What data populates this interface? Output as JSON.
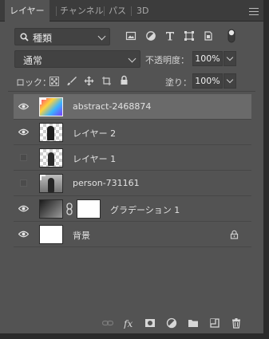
{
  "tabs": [
    {
      "label": "レイヤー",
      "active": true
    },
    {
      "label": "チャンネル",
      "active": false
    },
    {
      "label": "パス",
      "active": false
    },
    {
      "label": "3D",
      "active": false
    }
  ],
  "filter": {
    "label": "種類",
    "icons": [
      "image-filter-icon",
      "adjustment-filter-icon",
      "type-filter-icon",
      "shape-filter-icon",
      "smart-object-filter-icon",
      "filter-toggle-icon"
    ]
  },
  "blend": {
    "mode": "通常",
    "opacity_label": "不透明度：",
    "opacity_value": "100%"
  },
  "lock": {
    "label": "ロック：",
    "fill_label": "塗り：",
    "fill_value": "100%"
  },
  "layers": [
    {
      "name": "abstract-2468874",
      "visible": true,
      "selected": true
    },
    {
      "name": "レイヤー 2",
      "visible": true,
      "selected": false
    },
    {
      "name": "レイヤー 1",
      "visible": false,
      "selected": false
    },
    {
      "name": "person-731161",
      "visible": false,
      "selected": false
    },
    {
      "name": "グラデーション 1",
      "visible": true,
      "selected": false
    },
    {
      "name": "背景",
      "visible": true,
      "selected": false,
      "locked": true
    }
  ],
  "bottom_icons": [
    "link-layers-icon",
    "fx-icon",
    "add-mask-icon",
    "adjustment-layer-icon",
    "group-folder-icon",
    "new-layer-icon",
    "trash-icon"
  ],
  "colors": {
    "panel": "#535353",
    "selected_row": "#6a6a6a",
    "tabbar": "#3c3c3c"
  }
}
